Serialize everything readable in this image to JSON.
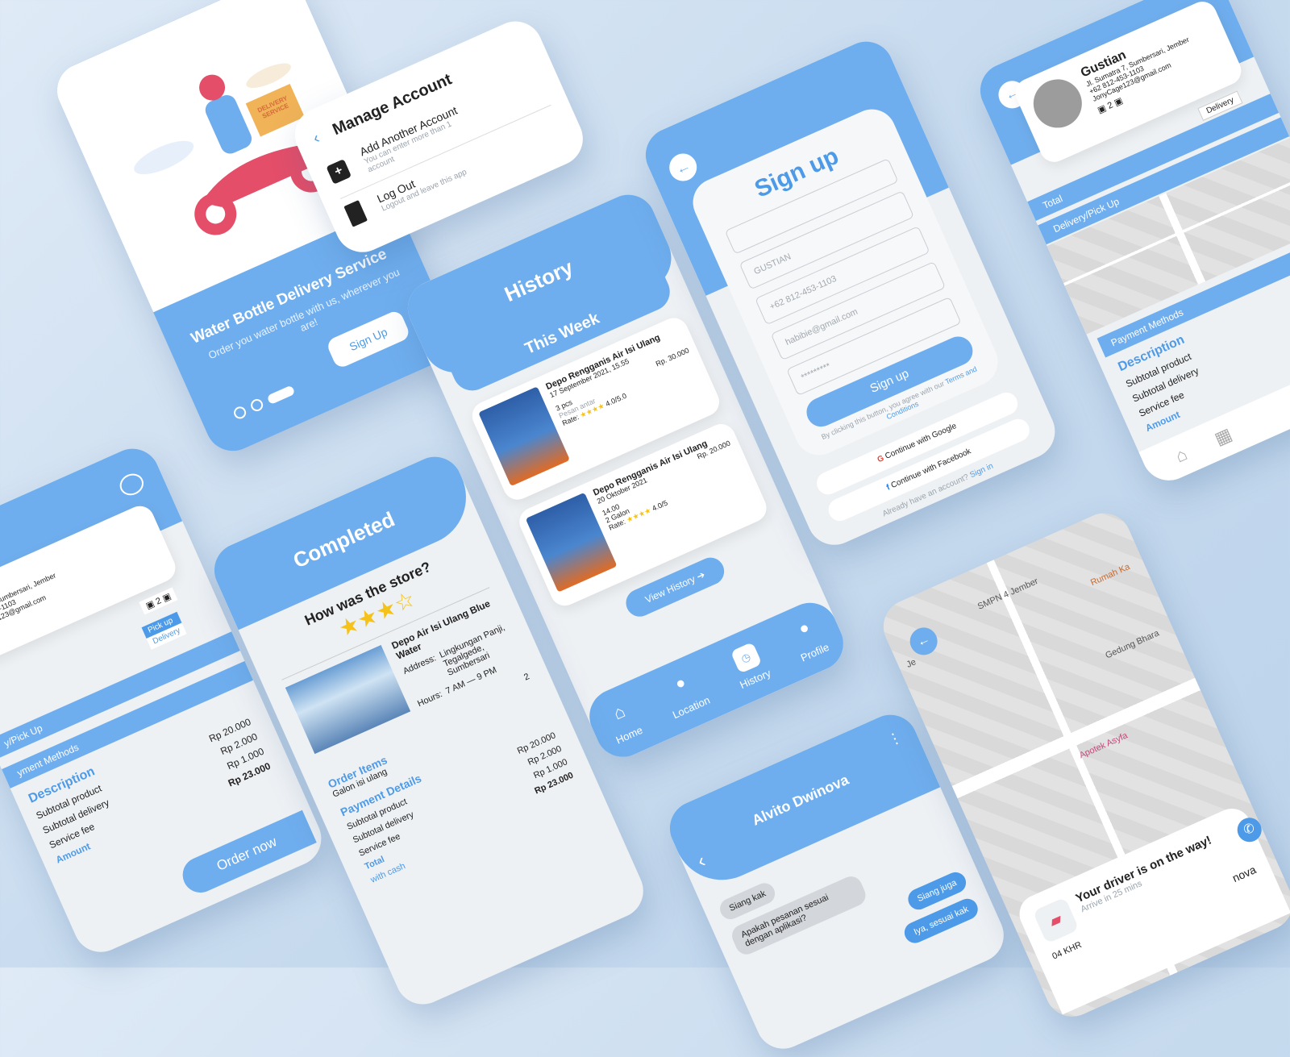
{
  "onboarding": {
    "title": "Water Bottle Delivery Service",
    "subtitle": "Order you water bottle with us, wherever you are!",
    "signup_button": "Sign Up",
    "box_text": "DELIVERY SERVICE"
  },
  "manage_account": {
    "top_bar": "Manage Acco",
    "title": "Manage Account",
    "items": [
      {
        "label": "Add Another Account",
        "sub": "You can enter more than 1 account"
      },
      {
        "label": "Log Out",
        "sub": "Logout and leave this app"
      }
    ]
  },
  "history": {
    "title": "History",
    "section": "This Week",
    "orders": [
      {
        "store": "Depo Rengganis Air Isi Ulang",
        "date": "17 September 2021, 15.55",
        "qty": "3 pcs",
        "note": "Pesan antar",
        "rate_label": "Rate:",
        "rating": "4.0/5.0",
        "price": "Rp. 30.000"
      },
      {
        "store": "Depo Rengganis Air Isi Ulang",
        "date": "20 Oktober 2021",
        "time": "14.00",
        "qty": "2 Galon",
        "rate_label": "Rate:",
        "rating": "4.0/5",
        "price": "Rp. 20.000"
      }
    ],
    "view_history": "View History",
    "nav": [
      {
        "label": "Home",
        "icon": "home-icon"
      },
      {
        "label": "Location",
        "icon": "location-pin-icon"
      },
      {
        "label": "History",
        "icon": "history-icon"
      },
      {
        "label": "Profile",
        "icon": "profile-icon"
      }
    ]
  },
  "signup": {
    "title": "Sign up",
    "name_value": "GUSTIAN",
    "phone_placeholder": "+62 812-453-1103",
    "email_placeholder": "habibie@gmail.com",
    "password_placeholder": "*********",
    "button": "Sign up",
    "terms_prefix": "By clicking this button, you agree with our",
    "terms_link": "Terms and Conditions",
    "google": "Continue with Google",
    "facebook": "Continue with Facebook",
    "already": "Already have an account?",
    "signin": "Sign in"
  },
  "checkout_right": {
    "name": "Gustian",
    "address": "Jl. Sumatra 7, Sumbersari, Jember",
    "phone": "+62 812-453-1103",
    "email": "JonyCage123@gmail.com",
    "qty": "2",
    "delivery_select": "Delivery",
    "total": "Total",
    "delivery_pickup": "Delivery/Pick Up",
    "payment_methods": "Payment Methods",
    "description": "Description",
    "rows": [
      "Subtotal product",
      "Subtotal delivery",
      "Service fee"
    ],
    "amount": "Amount"
  },
  "checkout_left": {
    "name": "an",
    "address": "atra 7, Sumbersari, Jember",
    "phone": "12-453-1103",
    "email": "Cage123@gmail.com",
    "qty": "2",
    "pickup": "Pick up",
    "delivery": "Delivery",
    "delivery_pickup": "y/Pick Up",
    "payment_methods": "yment Methods",
    "description": "Description",
    "rows": [
      {
        "label": "Subtotal product",
        "value": "Rp 20.000"
      },
      {
        "label": "Subtotal delivery",
        "value": "Rp 2.000"
      },
      {
        "label": "Service fee",
        "value": "Rp 1.000"
      }
    ],
    "amount": "Amount",
    "amount_value": "Rp 23.000",
    "order_now": "Order now"
  },
  "completed": {
    "title": "Completed",
    "question": "How was the store?",
    "store": "Depo Air Isi Ulang Blue Water",
    "address_label": "Address:",
    "address": "Lingkungan Panji, Tegalgede, Sumbersari",
    "hours_label": "Hours:",
    "hours": "7 AM — 9 PM",
    "count": "2",
    "order_items": "Order Items",
    "item": "Galon isi ulang",
    "payment_details": "Payment Details",
    "rows": [
      {
        "label": "Subtotal product",
        "value": "Rp 20.000"
      },
      {
        "label": "Subtotal delivery",
        "value": "Rp 2.000"
      },
      {
        "label": "Service fee",
        "value": "Rp 1.000"
      }
    ],
    "total": "Total",
    "total_value": "Rp 23.000",
    "cash": "with cash"
  },
  "chat": {
    "name": "Alvito Dwinova",
    "messages": [
      {
        "from": "them",
        "text": "Siang kak"
      },
      {
        "from": "them",
        "text": "Apakah pesanan sesuai dengan aplikasi?"
      },
      {
        "from": "me",
        "text": "Siang juga"
      },
      {
        "from": "me",
        "text": "Iya, sesuai kak"
      }
    ]
  },
  "map_phone": {
    "labels": [
      "SMPN 4 Jember",
      "Rumah Ka",
      "Gedung Bhara",
      "Apotek Asyfa",
      "Je"
    ],
    "driver_title": "Your driver is on the way!",
    "driver_sub": "Arrive in 25 mins",
    "price": "04 KHR",
    "driver_name": "nova"
  },
  "colors": {
    "accent": "#6faeee",
    "link": "#4d9be8",
    "star": "#f5c21b"
  }
}
